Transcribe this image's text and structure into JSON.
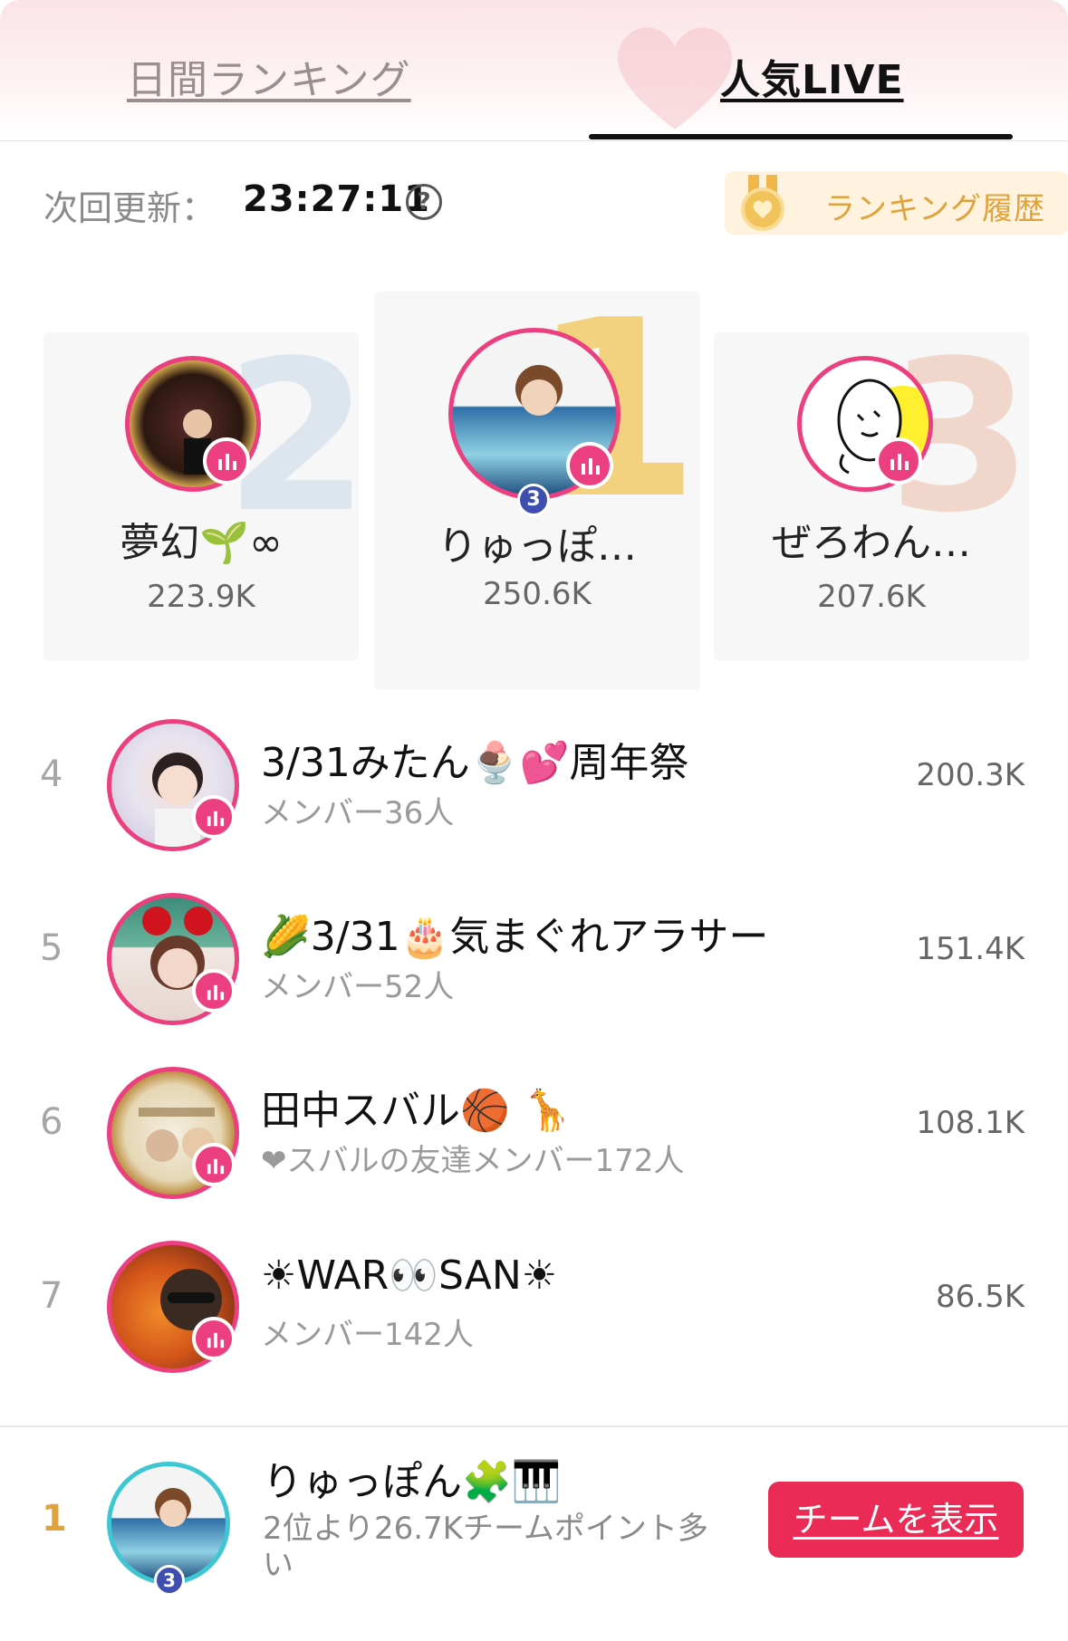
{
  "tabs": {
    "daily_label": "日間ランキング",
    "live_label": "人気LIVE"
  },
  "update": {
    "label": "次回更新：",
    "time": "23:27:11",
    "help_icon": "question-circle-icon"
  },
  "history_button": {
    "label": "ランキング履歴",
    "icon": "medal-icon"
  },
  "colors": {
    "accent": "#ec3f7f",
    "button": "#ea2b55",
    "gold": "#e0a23a"
  },
  "podium": [
    {
      "rank": "2",
      "name": "夢幻🌱∞",
      "score": "223.9K"
    },
    {
      "rank": "1",
      "name": "りゅっぽ…",
      "score": "250.6K",
      "level_badge": "3"
    },
    {
      "rank": "3",
      "name": "ぜろわん…",
      "score": "207.6K"
    }
  ],
  "list": [
    {
      "rank": "4",
      "name": "3/31みたん🍨💕周年祭",
      "members": "メンバー36人",
      "score": "200.3K"
    },
    {
      "rank": "5",
      "name": "🌽3/31🎂気まぐれアラサー",
      "members": "メンバー52人",
      "score": "151.4K"
    },
    {
      "rank": "6",
      "name": "田中スバル🏀 🦒",
      "members": "❤スバルの友達メンバー172人",
      "score": "108.1K"
    },
    {
      "rank": "7",
      "name": "☀WAR👀SAN☀",
      "members": "メンバー142人",
      "score": "86.5K"
    }
  ],
  "bottom": {
    "rank": "1",
    "name": "りゅっぽん🧩🎹",
    "subtitle": "2位より26.7Kチームポイント多い",
    "button_label": "チームを表示",
    "level_badge": "3"
  }
}
